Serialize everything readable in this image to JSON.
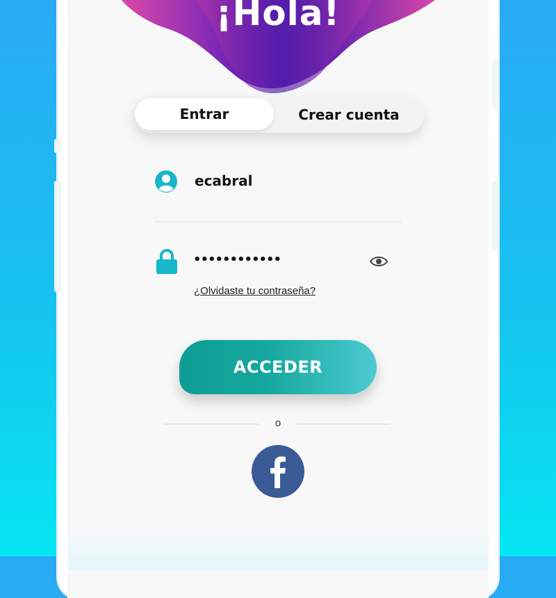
{
  "header": {
    "greeting": "¡Hola!"
  },
  "tabs": [
    {
      "label": "Entrar",
      "active": true
    },
    {
      "label": "Crear cuenta",
      "active": false
    }
  ],
  "login": {
    "username": {
      "value": "ecabral",
      "icon": "user-icon"
    },
    "password": {
      "value": "••••••••••••",
      "icon": "lock-icon",
      "toggle_icon": "eye-icon"
    },
    "forgot_link": "¿Olvidaste tu contraseña?",
    "submit_label": "ACCEDER"
  },
  "social": {
    "separator": "o",
    "facebook_icon": "facebook-icon",
    "facebook_glyph": "f"
  },
  "colors": {
    "accent_teal": "#17b6c9",
    "button_start": "#0e9d95",
    "button_end": "#4ccbd2",
    "facebook": "#3a5a96",
    "wave_purple": "#5a1fb0",
    "wave_pink": "#ef4fa8"
  }
}
